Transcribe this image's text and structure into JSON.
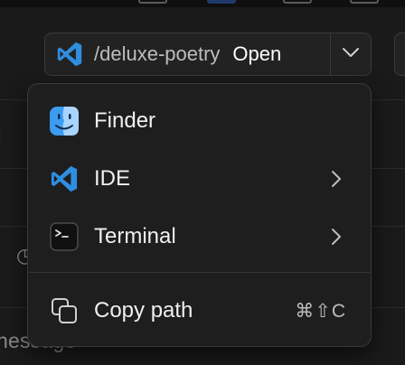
{
  "open_button": {
    "path": "/deluxe-poetry",
    "label": "Open",
    "icon": "vscode-icon"
  },
  "menu": {
    "items": [
      {
        "label": "Finder",
        "icon": "finder-icon",
        "has_submenu": false
      },
      {
        "label": "IDE",
        "icon": "vscode-icon",
        "has_submenu": true
      },
      {
        "label": "Terminal",
        "icon": "terminal-icon",
        "has_submenu": true
      },
      {
        "label": "Copy path",
        "icon": "copy-icon",
        "has_submenu": false,
        "shortcut": "⌘⇧C"
      }
    ]
  },
  "background": {
    "partial_text": "nessage"
  },
  "colors": {
    "vscode_blue": "#2f8ee0",
    "finder_blue": "#3d9bf0",
    "menu_bg": "#1e1e1e",
    "page_bg": "#1a1a1a"
  }
}
